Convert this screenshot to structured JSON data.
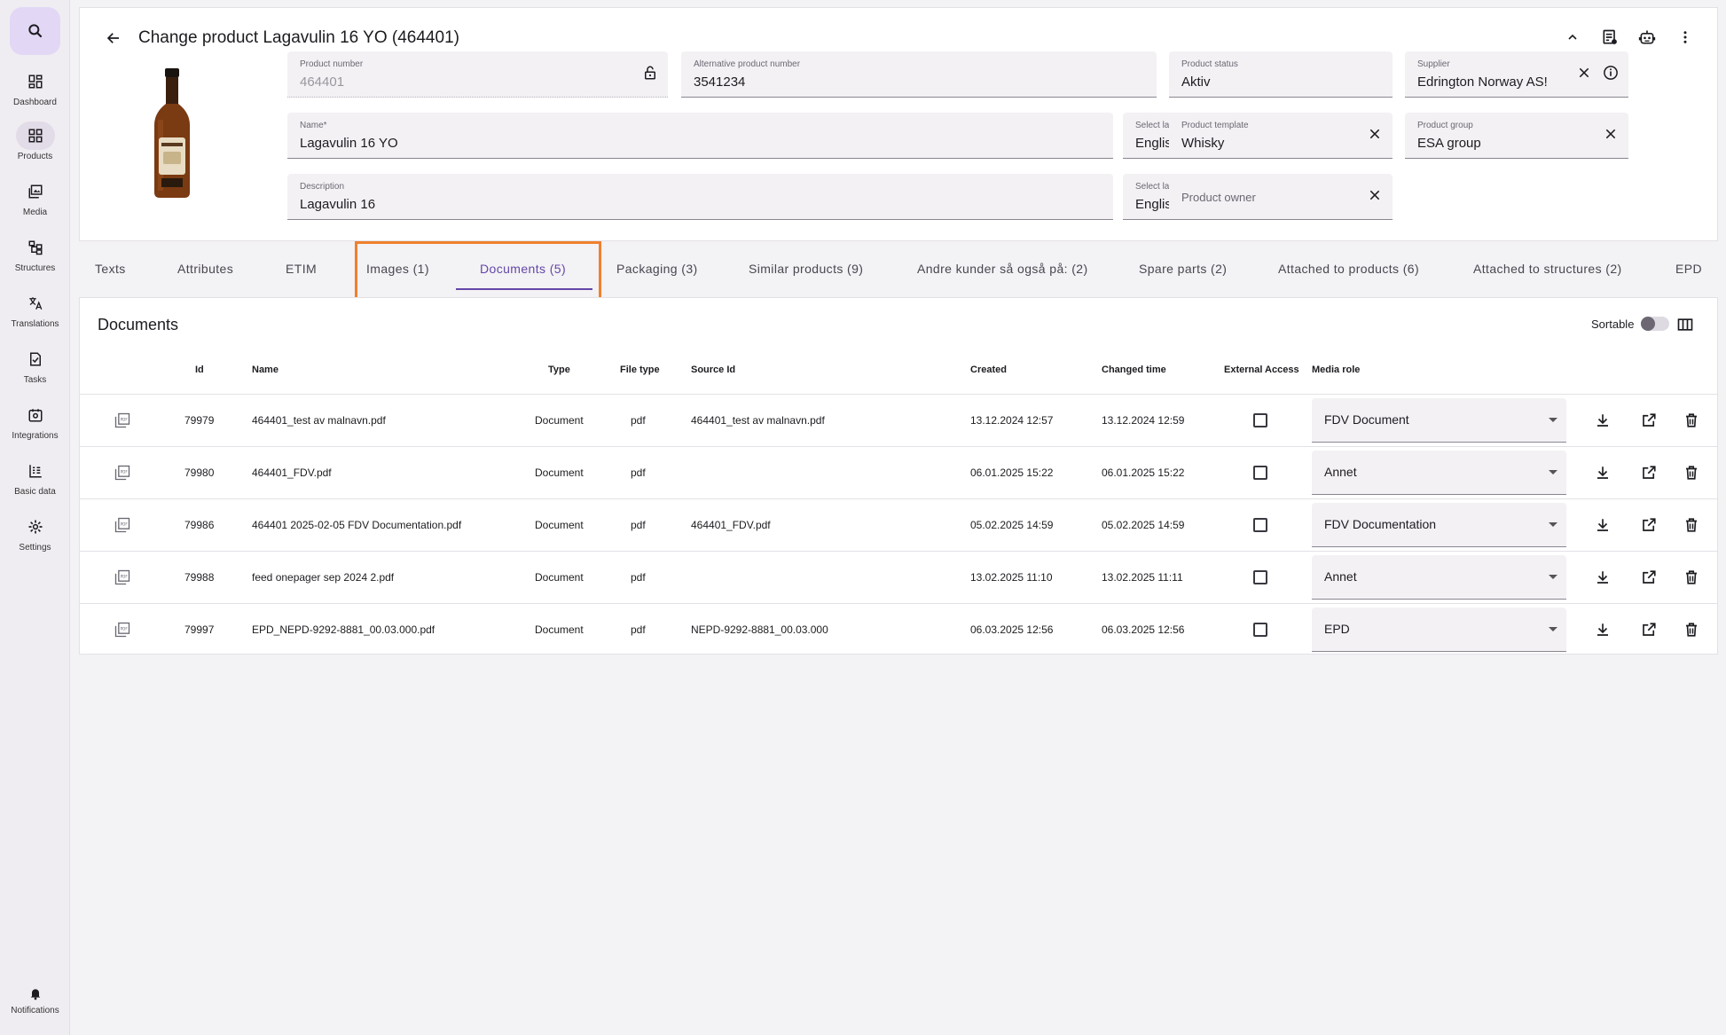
{
  "sidebar": {
    "items": [
      {
        "label": "Dashboard",
        "icon": "dashboard-icon"
      },
      {
        "label": "Products",
        "icon": "products-icon",
        "active": true
      },
      {
        "label": "Media",
        "icon": "media-icon"
      },
      {
        "label": "Structures",
        "icon": "structures-icon"
      },
      {
        "label": "Translations",
        "icon": "translate-icon"
      },
      {
        "label": "Tasks",
        "icon": "tasks-icon"
      },
      {
        "label": "Integrations",
        "icon": "integrations-icon"
      },
      {
        "label": "Basic data",
        "icon": "basic-data-icon"
      },
      {
        "label": "Settings",
        "icon": "settings-icon"
      }
    ],
    "notifications_label": "Notifications"
  },
  "header": {
    "title": "Change product Lagavulin 16 YO (464401)"
  },
  "fields": {
    "product_number": {
      "label": "Product number",
      "value": "464401"
    },
    "alt_product_number": {
      "label": "Alternative product number",
      "value": "3541234"
    },
    "product_status": {
      "label": "Product status",
      "value": "Aktiv"
    },
    "supplier": {
      "label": "Supplier",
      "value": "Edrington Norway AS!"
    },
    "name": {
      "label": "Name*",
      "value": "Lagavulin 16 YO"
    },
    "name_language": {
      "label": "Select language",
      "value": "English"
    },
    "product_template": {
      "label": "Product template",
      "value": "Whisky"
    },
    "product_group": {
      "label": "Product group",
      "value": "ESA group"
    },
    "description": {
      "label": "Description",
      "value": "Lagavulin 16"
    },
    "description_language": {
      "label": "Select language",
      "value": "English"
    },
    "product_owner": {
      "placeholder": "Product owner"
    }
  },
  "tabs": [
    "Texts",
    "Attributes",
    "ETIM",
    "Images (1)",
    "Documents (5)",
    "Packaging (3)",
    "Similar products (9)",
    "Andre kunder så også på: (2)",
    "Spare parts (2)",
    "Attached to products (6)",
    "Attached to structures (2)",
    "EPD"
  ],
  "active_tab": "Documents (5)",
  "documents": {
    "title": "Documents",
    "sortable_label": "Sortable",
    "sortable_on": false,
    "columns": [
      "Id",
      "Name",
      "Type",
      "File type",
      "Source Id",
      "Created",
      "Changed time",
      "External Access",
      "Media role"
    ],
    "rows": [
      {
        "id": "79979",
        "name": "464401_test av malnavn.pdf",
        "type": "Document",
        "file_type": "pdf",
        "source_id": "464401_test av malnavn.pdf",
        "created": "13.12.2024 12:57",
        "changed": "13.12.2024 12:59",
        "external_access": false,
        "media_role": "FDV Document"
      },
      {
        "id": "79980",
        "name": "464401_FDV.pdf",
        "type": "Document",
        "file_type": "pdf",
        "source_id": "",
        "created": "06.01.2025 15:22",
        "changed": "06.01.2025 15:22",
        "external_access": false,
        "media_role": "Annet"
      },
      {
        "id": "79986",
        "name": "464401 2025-02-05 FDV Documentation.pdf",
        "type": "Document",
        "file_type": "pdf",
        "source_id": "464401_FDV.pdf",
        "created": "05.02.2025 14:59",
        "changed": "05.02.2025 14:59",
        "external_access": false,
        "media_role": "FDV Documentation"
      },
      {
        "id": "79988",
        "name": "feed onepager sep 2024 2.pdf",
        "type": "Document",
        "file_type": "pdf",
        "source_id": "",
        "created": "13.02.2025 11:10",
        "changed": "13.02.2025 11:11",
        "external_access": false,
        "media_role": "Annet"
      },
      {
        "id": "79997",
        "name": "EPD_NEPD-9292-8881_00.03.000.pdf",
        "type": "Document",
        "file_type": "pdf",
        "source_id": "NEPD-9292-8881_00.03.000",
        "created": "06.03.2025 12:56",
        "changed": "06.03.2025 12:56",
        "external_access": false,
        "media_role": "EPD"
      }
    ]
  },
  "colors": {
    "accent": "#6447a8",
    "highlight": "#f0802d"
  }
}
